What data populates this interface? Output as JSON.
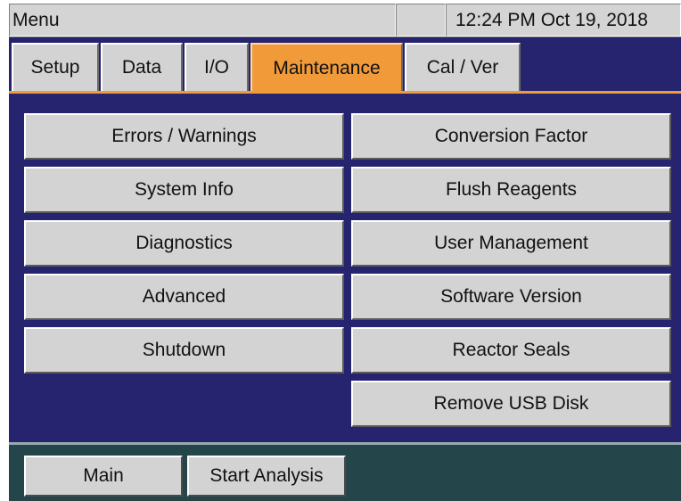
{
  "titlebar": {
    "menu_label": "Menu",
    "datetime": "12:24 PM Oct 19, 2018"
  },
  "tabs": [
    {
      "label": "Setup",
      "active": false
    },
    {
      "label": "Data",
      "active": false
    },
    {
      "label": "I/O",
      "active": false
    },
    {
      "label": "Maintenance",
      "active": true
    },
    {
      "label": "Cal / Ver",
      "active": false
    }
  ],
  "menu": {
    "left": [
      "Errors / Warnings",
      "System Info",
      "Diagnostics",
      "Advanced",
      "Shutdown"
    ],
    "right": [
      "Conversion Factor",
      "Flush Reagents",
      "User Management",
      "Software Version",
      "Reactor Seals",
      "Remove USB Disk"
    ]
  },
  "bottom": {
    "main_label": "Main",
    "start_label": "Start Analysis"
  },
  "colors": {
    "panel_bg": "#27246f",
    "active_tab": "#f09a3a",
    "button_bg": "#d3d3d3",
    "bottom_bg": "#24464a"
  }
}
